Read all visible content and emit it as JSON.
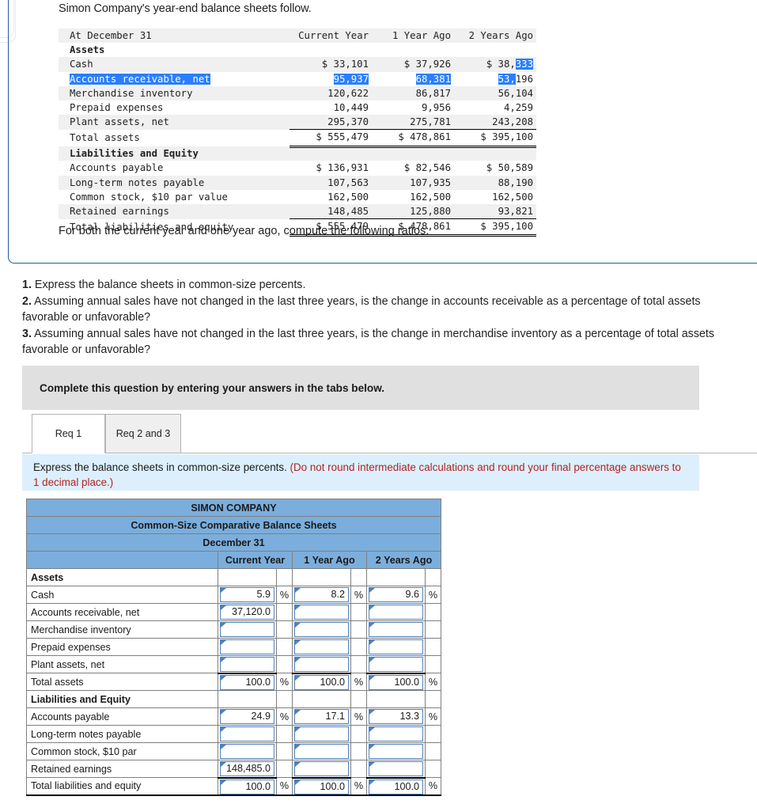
{
  "intro": "Simon Company's year-end balance sheets follow.",
  "balance_sheet": {
    "columns": [
      "At December 31",
      "Current Year",
      "1 Year Ago",
      "2 Years Ago"
    ],
    "sections": [
      {
        "heading": "Assets",
        "rows": [
          {
            "label": "Cash",
            "values": [
              "$ 33,101",
              "$ 37,926",
              "$ 38,333"
            ]
          },
          {
            "label": "Accounts receivable, net",
            "values": [
              "95,937",
              "68,381",
              "53,196"
            ]
          },
          {
            "label": "Merchandise inventory",
            "values": [
              "120,622",
              "86,817",
              "56,104"
            ]
          },
          {
            "label": "Prepaid expenses",
            "values": [
              "10,449",
              "9,956",
              "4,259"
            ]
          },
          {
            "label": "Plant assets, net",
            "values": [
              "295,370",
              "275,781",
              "243,208"
            ]
          }
        ],
        "total": {
          "label": "Total assets",
          "values": [
            "$ 555,479",
            "$ 478,861",
            "$ 395,100"
          ]
        }
      },
      {
        "heading": "Liabilities and Equity",
        "rows": [
          {
            "label": "Accounts payable",
            "values": [
              "$ 136,931",
              "$ 82,546",
              "$ 50,589"
            ]
          },
          {
            "label": "Long-term notes payable",
            "values": [
              "107,563",
              "107,935",
              "88,190"
            ]
          },
          {
            "label": "Common stock, $10 par value",
            "values": [
              "162,500",
              "162,500",
              "162,500"
            ]
          },
          {
            "label": "Retained earnings",
            "values": [
              "148,485",
              "125,880",
              "93,821"
            ]
          }
        ],
        "total": {
          "label": "Total liabilities and equity",
          "values": [
            "$ 555,479",
            "$ 478,861",
            "$ 395,100"
          ]
        }
      }
    ]
  },
  "for_both_line": "For both the current year and one year ago, compute the following ratios:",
  "requirements": [
    {
      "num": "1.",
      "text": "Express the balance sheets in common-size percents."
    },
    {
      "num": "2.",
      "text": "Assuming annual sales have not changed in the last three years, is the change in accounts receivable as a percentage of total assets favorable or unfavorable?"
    },
    {
      "num": "3.",
      "text": "Assuming annual sales have not changed in the last three years, is the change in merchandise inventory as a percentage of total assets favorable or unfavorable?"
    }
  ],
  "instruction_bar": "Complete this question by entering your answers in the tabs below.",
  "tabs": [
    {
      "label": "Req 1",
      "active": true
    },
    {
      "label": "Req 2 and 3",
      "active": false
    }
  ],
  "blue_instruction": {
    "main": "Express the balance sheets in common-size percents.",
    "note": "(Do not round intermediate calculations and round your final percentage answers to 1 decimal place.)"
  },
  "answer_grid": {
    "titles": [
      "SIMON COMPANY",
      "Common-Size Comparative Balance Sheets",
      "December 31"
    ],
    "col_headers": [
      "Current Year",
      "1 Year Ago",
      "2 Years Ago"
    ],
    "percent_symbol": "%",
    "rows": [
      {
        "label": "Assets",
        "type": "heading",
        "values": [
          "",
          "",
          ""
        ],
        "pct": [
          false,
          false,
          false
        ]
      },
      {
        "label": "Cash",
        "type": "input",
        "values": [
          "5.9",
          "8.2",
          "9.6"
        ],
        "pct": [
          true,
          true,
          true
        ]
      },
      {
        "label": "Accounts receivable, net",
        "type": "input",
        "values": [
          "37,120.0",
          "",
          ""
        ],
        "pct": [
          false,
          false,
          false
        ]
      },
      {
        "label": "Merchandise inventory",
        "type": "input",
        "values": [
          "",
          "",
          ""
        ],
        "pct": [
          false,
          false,
          false
        ]
      },
      {
        "label": "Prepaid expenses",
        "type": "input",
        "values": [
          "",
          "",
          ""
        ],
        "pct": [
          false,
          false,
          false
        ]
      },
      {
        "label": "Plant assets, net",
        "type": "input",
        "values": [
          "",
          "",
          ""
        ],
        "pct": [
          false,
          false,
          false
        ]
      },
      {
        "label": "Total assets",
        "type": "total",
        "values": [
          "100.0",
          "100.0",
          "100.0"
        ],
        "pct": [
          true,
          true,
          true
        ]
      },
      {
        "label": "Liabilities and Equity",
        "type": "heading",
        "values": [
          "",
          "",
          ""
        ],
        "pct": [
          false,
          false,
          false
        ]
      },
      {
        "label": "Accounts payable",
        "type": "input",
        "values": [
          "24.9",
          "17.1",
          "13.3"
        ],
        "pct": [
          true,
          true,
          true
        ]
      },
      {
        "label": "Long-term notes payable",
        "type": "input",
        "values": [
          "",
          "",
          ""
        ],
        "pct": [
          false,
          false,
          false
        ]
      },
      {
        "label": "Common stock, $10 par",
        "type": "input",
        "values": [
          "",
          "",
          ""
        ],
        "pct": [
          false,
          false,
          false
        ]
      },
      {
        "label": "Retained earnings",
        "type": "input",
        "values": [
          "148,485.0",
          "",
          ""
        ],
        "pct": [
          false,
          false,
          false
        ]
      },
      {
        "label": "Total liabilities and equity",
        "type": "total",
        "values": [
          "100.0",
          "100.0",
          "100.0"
        ],
        "pct": [
          true,
          true,
          true
        ]
      }
    ]
  },
  "selection": {
    "row_label": "Accounts receivable, net",
    "highlight_color": "#2a7fff"
  }
}
